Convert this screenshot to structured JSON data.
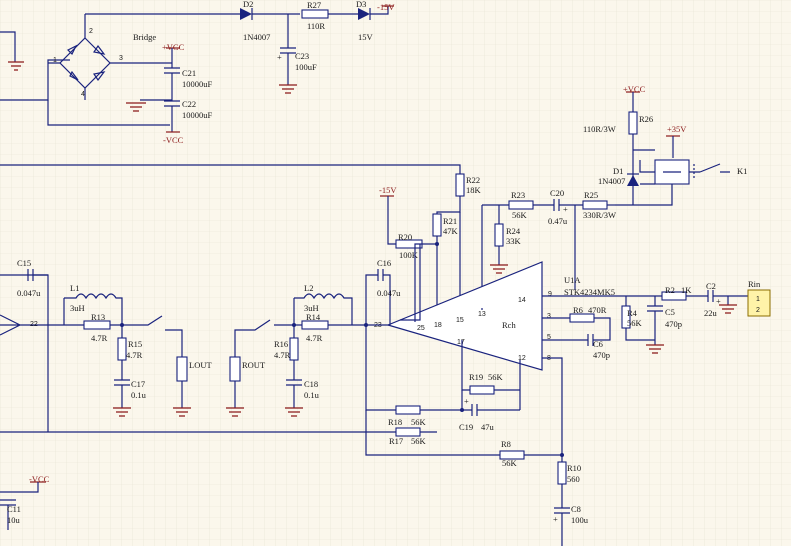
{
  "colors": {
    "background": "#fbf7ec",
    "grid": "#e6e2d3",
    "wire": "#1a237e",
    "power": "#8b1a1a",
    "connector": "#fff3a8"
  },
  "power_labels": {
    "vcc_pos": "+VCC",
    "vcc_neg": "-VCC",
    "v15_neg": "-15V",
    "v35_pos": "+35V"
  },
  "bridge": {
    "label": "Bridge",
    "pins": [
      "1",
      "2",
      "3",
      "4"
    ]
  },
  "components": {
    "D2": {
      "ref": "D2",
      "value": "1N4007"
    },
    "R27": {
      "ref": "R27",
      "value": "110R"
    },
    "D3": {
      "ref": "D3",
      "value": "15V"
    },
    "C23": {
      "ref": "C23",
      "value": "100uF"
    },
    "C21": {
      "ref": "C21",
      "value": "10000uF"
    },
    "C22": {
      "ref": "C22",
      "value": "10000uF"
    },
    "R26": {
      "ref": "R26",
      "value": "110R/3W"
    },
    "D1": {
      "ref": "D1",
      "value": "1N4007"
    },
    "K1": {
      "ref": "K1"
    },
    "R22": {
      "ref": "R22",
      "value": "18K"
    },
    "R21": {
      "ref": "R21",
      "value": "47K"
    },
    "R20": {
      "ref": "R20",
      "value": "100K"
    },
    "R23": {
      "ref": "R23",
      "value": "56K"
    },
    "R24": {
      "ref": "R24",
      "value": "33K"
    },
    "C20": {
      "ref": "C20",
      "value": "0.47u"
    },
    "R25": {
      "ref": "R25",
      "value": "330R/3W"
    },
    "C15": {
      "ref": "C15",
      "value": "0.047u"
    },
    "C16": {
      "ref": "C16",
      "value": "0.047u"
    },
    "L1": {
      "ref": "L1",
      "value": "3uH"
    },
    "L2": {
      "ref": "L2",
      "value": "3uH"
    },
    "R13": {
      "ref": "R13",
      "value": "4.7R"
    },
    "R14": {
      "ref": "R14",
      "value": "4.7R"
    },
    "R15": {
      "ref": "R15",
      "value": "4.7R"
    },
    "R16": {
      "ref": "R16",
      "value": "4.7R"
    },
    "C17": {
      "ref": "C17",
      "value": "0.1u"
    },
    "C18": {
      "ref": "C18",
      "value": "0.1u"
    },
    "LOUT": {
      "ref": "LOUT"
    },
    "ROUT": {
      "ref": "ROUT"
    },
    "U1A": {
      "ref": "U1A",
      "value": "STK4234MK5",
      "channel": "Rch"
    },
    "R2": {
      "ref": "R2",
      "value": "1K"
    },
    "C2": {
      "ref": "C2",
      "value": "22u"
    },
    "R4": {
      "ref": "R4",
      "value": "56K"
    },
    "C5": {
      "ref": "C5",
      "value": "470p"
    },
    "R6": {
      "ref": "R6",
      "value": "470R"
    },
    "C6": {
      "ref": "C6",
      "value": "470p"
    },
    "R19": {
      "ref": "R19",
      "value": "56K"
    },
    "R18": {
      "ref": "R18",
      "value": "56K"
    },
    "R17": {
      "ref": "R17",
      "value": "56K"
    },
    "C19": {
      "ref": "C19",
      "value": "47u"
    },
    "R8": {
      "ref": "R8",
      "value": "56K"
    },
    "R10": {
      "ref": "R10",
      "value": "560"
    },
    "C8": {
      "ref": "C8",
      "value": "100u"
    },
    "C11": {
      "ref": "C11",
      "value": "10u"
    },
    "Rin": {
      "ref": "Rin",
      "pins": [
        "1",
        "2"
      ]
    }
  },
  "ic_pins": {
    "p9": "9",
    "p14": "14",
    "p3": "3",
    "p5": "5",
    "p12": "12",
    "p8": "8",
    "p18": "18",
    "p15": "15",
    "p13": "13",
    "p25": "25",
    "p17": "17",
    "p23": "23",
    "p22": "22"
  },
  "polarity": {
    "plus": "+"
  }
}
